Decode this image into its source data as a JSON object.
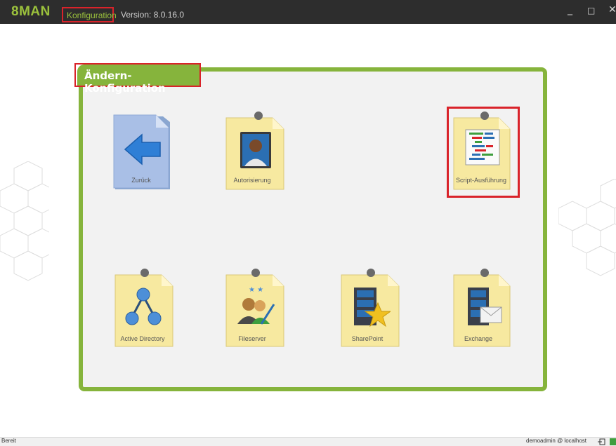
{
  "app": {
    "brand": "8MAN",
    "menu_item": "Konfiguration",
    "version": "Version: 8.0.16.0"
  },
  "window_controls": {
    "minimize": "_",
    "maximize": "□",
    "close": "✕"
  },
  "panel": {
    "title": "Ändern-Konfiguration"
  },
  "tiles": [
    {
      "label": "Zurück"
    },
    {
      "label": "Autorisierung"
    },
    {
      "label": "Script-Ausführung"
    },
    {
      "label": "Active Directory"
    },
    {
      "label": "Fileserver"
    },
    {
      "label": "SharePoint"
    },
    {
      "label": "Exchange"
    }
  ],
  "status": {
    "left": "Bereit",
    "right": "demoadmin @ localhost"
  },
  "colors": {
    "accent": "#86b43c",
    "highlight": "#d9232a",
    "titlebar": "#2d2d2d"
  }
}
